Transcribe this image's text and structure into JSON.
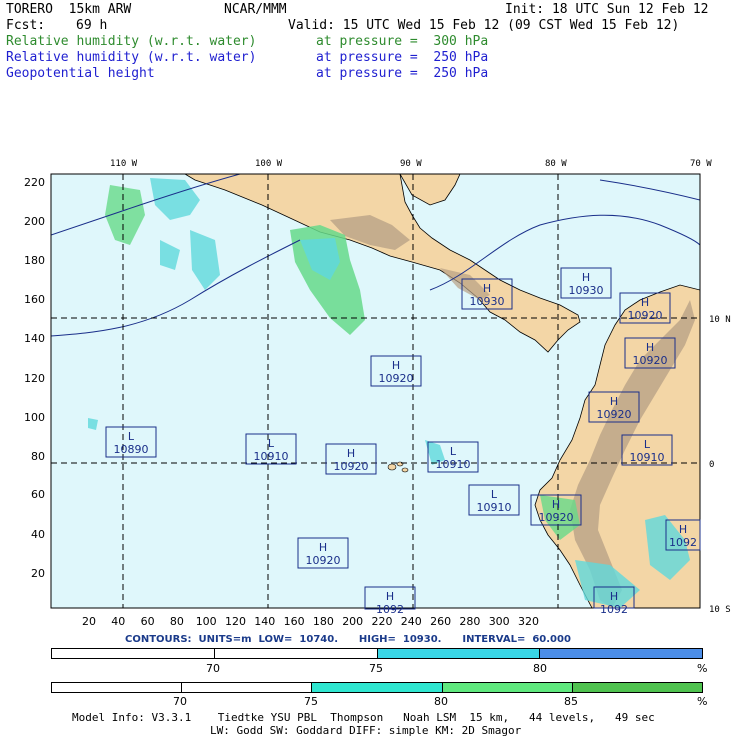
{
  "header": {
    "model": "TORERO  15km ARW",
    "center": "NCAR/MMM",
    "init": "Init: 18 UTC Sun 12 Feb 12",
    "fcst_label": "Fcst:",
    "fcst_value": "69 h",
    "valid": "Valid: 15 UTC Wed 15 Feb 12 (09 CST Wed 15 Feb 12)",
    "fields": [
      {
        "name": "Relative humidity (w.r.t. water)",
        "level": "at pressure =  300 hPa",
        "color": "#2e8b2e"
      },
      {
        "name": "Relative humidity (w.r.t. water)",
        "level": "at pressure =  250 hPa",
        "color": "#1f1fd0"
      },
      {
        "name": "Geopotential height",
        "level": "at pressure =  250 hPa",
        "color": "#1f1fd0"
      }
    ]
  },
  "map": {
    "top_lon_labels": [
      "110 W",
      "100 W",
      "90 W",
      "80 W",
      "70 W"
    ],
    "right_lat_labels": [
      "10 N",
      "0",
      "10 S"
    ],
    "y_ticks": [
      "220",
      "200",
      "180",
      "160",
      "140",
      "120",
      "100",
      "80",
      "60",
      "40",
      "20"
    ],
    "x_ticks": [
      "20",
      "40",
      "60",
      "80",
      "100",
      "120",
      "140",
      "160",
      "180",
      "200",
      "220",
      "240",
      "260",
      "280",
      "300",
      "320"
    ],
    "highs_lows": [
      {
        "type": "H",
        "value": "10930"
      },
      {
        "type": "H",
        "value": "10930"
      },
      {
        "type": "H",
        "value": "10920"
      },
      {
        "type": "H",
        "value": "10920"
      },
      {
        "type": "H",
        "value": "10920"
      },
      {
        "type": "H",
        "value": "10920"
      },
      {
        "type": "L",
        "value": "10890"
      },
      {
        "type": "L",
        "value": "10910"
      },
      {
        "type": "H",
        "value": "10920"
      },
      {
        "type": "L",
        "value": "10910"
      },
      {
        "type": "L",
        "value": "10910"
      },
      {
        "type": "L",
        "value": "10910"
      },
      {
        "type": "H",
        "value": "10920"
      },
      {
        "type": "H",
        "value": "10920"
      },
      {
        "type": "H",
        "value": "1092"
      },
      {
        "type": "H",
        "value": "1092"
      },
      {
        "type": "H",
        "value": "1092"
      }
    ],
    "colors": {
      "ocean": "#dff7fb",
      "land": "#f3d6a6",
      "mountain": "#b69f84",
      "rh_green": "#66d98a",
      "rh_cyan": "#5fd8dc",
      "contour": "#1a2f8a"
    }
  },
  "contours_text": "CONTOURS:  UNITS=m  LOW=  10740.      HIGH=  10930.      INTERVAL=  60.000",
  "colorbar1": {
    "labels": [
      "70",
      "75",
      "80"
    ],
    "unit": "%",
    "colors": [
      "#ffffff",
      "#ffffff",
      "#3ad6e6",
      "#4c8ee8"
    ]
  },
  "colorbar2": {
    "labels": [
      "70",
      "75",
      "80",
      "85"
    ],
    "unit": "%",
    "colors": [
      "#ffffff",
      "#ffffff",
      "#2fe6d0",
      "#5fe87e",
      "#4fc24f"
    ]
  },
  "footer": {
    "line1": "Model Info: V3.3.1    Tiedtke YSU PBL  Thompson   Noah LSM  15 km,   44 levels,   49 sec",
    "line2": "LW: Godd SW: Goddard DIFF: simple KM: 2D Smagor"
  }
}
